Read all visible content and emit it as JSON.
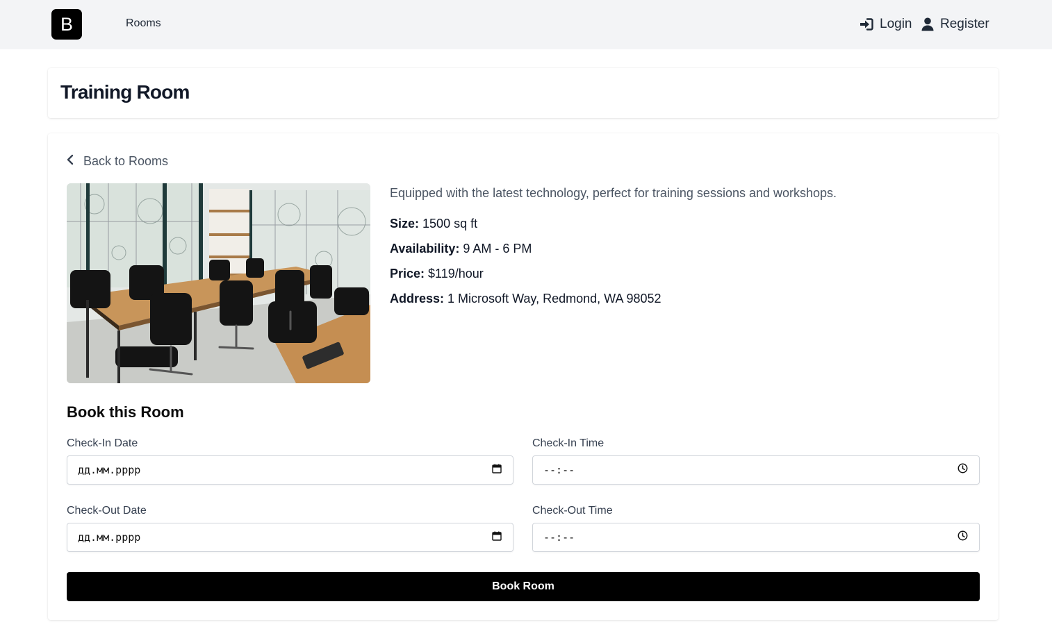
{
  "header": {
    "logo_letter": "B",
    "nav": {
      "rooms_label": "Rooms"
    },
    "auth": {
      "login_label": "Login",
      "register_label": "Register"
    }
  },
  "page": {
    "title": "Training Room"
  },
  "room": {
    "back_label": "Back to Rooms",
    "description": "Equipped with the latest technology, perfect for training sessions and workshops.",
    "details": {
      "size": {
        "label": "Size:",
        "value": "1500 sq ft"
      },
      "availability": {
        "label": "Availability:",
        "value": "9 AM - 6 PM"
      },
      "price": {
        "label": "Price:",
        "value": "$119/hour"
      },
      "address": {
        "label": "Address:",
        "value": "1 Microsoft Way, Redmond, WA 98052"
      }
    }
  },
  "booking": {
    "heading": "Book this Room",
    "check_in_date": {
      "label": "Check-In Date",
      "value": "дд.мм.рррр",
      "icon": "calendar-icon"
    },
    "check_in_time": {
      "label": "Check-In Time",
      "value": "--:--",
      "icon": "clock-icon"
    },
    "check_out_date": {
      "label": "Check-Out Date",
      "value": "дд.мм.рррр",
      "icon": "calendar-icon"
    },
    "check_out_time": {
      "label": "Check-Out Time",
      "value": "--:--",
      "icon": "clock-icon"
    },
    "submit_label": "Book Room"
  },
  "colors": {
    "header_bg": "#f3f4f6",
    "button_bg": "#000000",
    "text_primary": "#111827",
    "text_muted": "#4b5563"
  }
}
